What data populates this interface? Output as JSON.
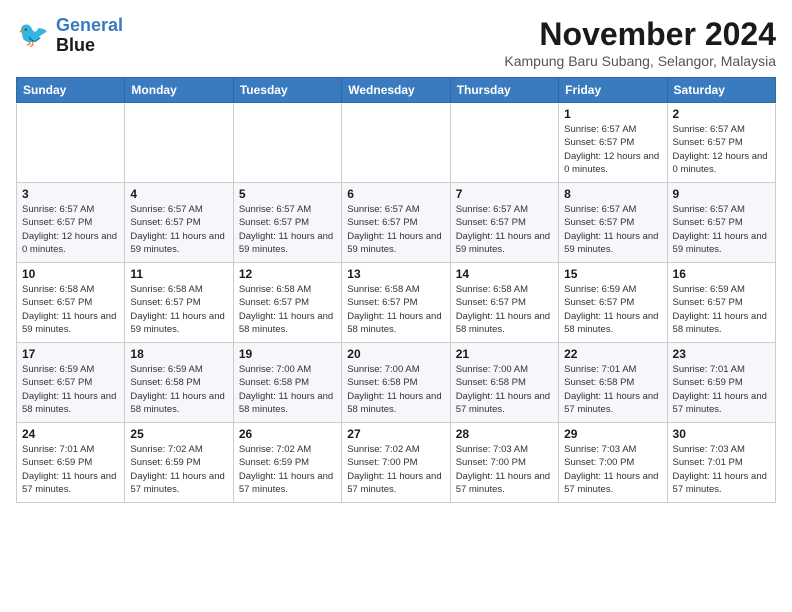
{
  "header": {
    "logo_line1": "General",
    "logo_line2": "Blue",
    "month": "November 2024",
    "location": "Kampung Baru Subang, Selangor, Malaysia"
  },
  "days_of_week": [
    "Sunday",
    "Monday",
    "Tuesday",
    "Wednesday",
    "Thursday",
    "Friday",
    "Saturday"
  ],
  "weeks": [
    [
      {
        "day": "",
        "info": ""
      },
      {
        "day": "",
        "info": ""
      },
      {
        "day": "",
        "info": ""
      },
      {
        "day": "",
        "info": ""
      },
      {
        "day": "",
        "info": ""
      },
      {
        "day": "1",
        "info": "Sunrise: 6:57 AM\nSunset: 6:57 PM\nDaylight: 12 hours and 0 minutes."
      },
      {
        "day": "2",
        "info": "Sunrise: 6:57 AM\nSunset: 6:57 PM\nDaylight: 12 hours and 0 minutes."
      }
    ],
    [
      {
        "day": "3",
        "info": "Sunrise: 6:57 AM\nSunset: 6:57 PM\nDaylight: 12 hours and 0 minutes."
      },
      {
        "day": "4",
        "info": "Sunrise: 6:57 AM\nSunset: 6:57 PM\nDaylight: 11 hours and 59 minutes."
      },
      {
        "day": "5",
        "info": "Sunrise: 6:57 AM\nSunset: 6:57 PM\nDaylight: 11 hours and 59 minutes."
      },
      {
        "day": "6",
        "info": "Sunrise: 6:57 AM\nSunset: 6:57 PM\nDaylight: 11 hours and 59 minutes."
      },
      {
        "day": "7",
        "info": "Sunrise: 6:57 AM\nSunset: 6:57 PM\nDaylight: 11 hours and 59 minutes."
      },
      {
        "day": "8",
        "info": "Sunrise: 6:57 AM\nSunset: 6:57 PM\nDaylight: 11 hours and 59 minutes."
      },
      {
        "day": "9",
        "info": "Sunrise: 6:57 AM\nSunset: 6:57 PM\nDaylight: 11 hours and 59 minutes."
      }
    ],
    [
      {
        "day": "10",
        "info": "Sunrise: 6:58 AM\nSunset: 6:57 PM\nDaylight: 11 hours and 59 minutes."
      },
      {
        "day": "11",
        "info": "Sunrise: 6:58 AM\nSunset: 6:57 PM\nDaylight: 11 hours and 59 minutes."
      },
      {
        "day": "12",
        "info": "Sunrise: 6:58 AM\nSunset: 6:57 PM\nDaylight: 11 hours and 58 minutes."
      },
      {
        "day": "13",
        "info": "Sunrise: 6:58 AM\nSunset: 6:57 PM\nDaylight: 11 hours and 58 minutes."
      },
      {
        "day": "14",
        "info": "Sunrise: 6:58 AM\nSunset: 6:57 PM\nDaylight: 11 hours and 58 minutes."
      },
      {
        "day": "15",
        "info": "Sunrise: 6:59 AM\nSunset: 6:57 PM\nDaylight: 11 hours and 58 minutes."
      },
      {
        "day": "16",
        "info": "Sunrise: 6:59 AM\nSunset: 6:57 PM\nDaylight: 11 hours and 58 minutes."
      }
    ],
    [
      {
        "day": "17",
        "info": "Sunrise: 6:59 AM\nSunset: 6:57 PM\nDaylight: 11 hours and 58 minutes."
      },
      {
        "day": "18",
        "info": "Sunrise: 6:59 AM\nSunset: 6:58 PM\nDaylight: 11 hours and 58 minutes."
      },
      {
        "day": "19",
        "info": "Sunrise: 7:00 AM\nSunset: 6:58 PM\nDaylight: 11 hours and 58 minutes."
      },
      {
        "day": "20",
        "info": "Sunrise: 7:00 AM\nSunset: 6:58 PM\nDaylight: 11 hours and 58 minutes."
      },
      {
        "day": "21",
        "info": "Sunrise: 7:00 AM\nSunset: 6:58 PM\nDaylight: 11 hours and 57 minutes."
      },
      {
        "day": "22",
        "info": "Sunrise: 7:01 AM\nSunset: 6:58 PM\nDaylight: 11 hours and 57 minutes."
      },
      {
        "day": "23",
        "info": "Sunrise: 7:01 AM\nSunset: 6:59 PM\nDaylight: 11 hours and 57 minutes."
      }
    ],
    [
      {
        "day": "24",
        "info": "Sunrise: 7:01 AM\nSunset: 6:59 PM\nDaylight: 11 hours and 57 minutes."
      },
      {
        "day": "25",
        "info": "Sunrise: 7:02 AM\nSunset: 6:59 PM\nDaylight: 11 hours and 57 minutes."
      },
      {
        "day": "26",
        "info": "Sunrise: 7:02 AM\nSunset: 6:59 PM\nDaylight: 11 hours and 57 minutes."
      },
      {
        "day": "27",
        "info": "Sunrise: 7:02 AM\nSunset: 7:00 PM\nDaylight: 11 hours and 57 minutes."
      },
      {
        "day": "28",
        "info": "Sunrise: 7:03 AM\nSunset: 7:00 PM\nDaylight: 11 hours and 57 minutes."
      },
      {
        "day": "29",
        "info": "Sunrise: 7:03 AM\nSunset: 7:00 PM\nDaylight: 11 hours and 57 minutes."
      },
      {
        "day": "30",
        "info": "Sunrise: 7:03 AM\nSunset: 7:01 PM\nDaylight: 11 hours and 57 minutes."
      }
    ]
  ]
}
